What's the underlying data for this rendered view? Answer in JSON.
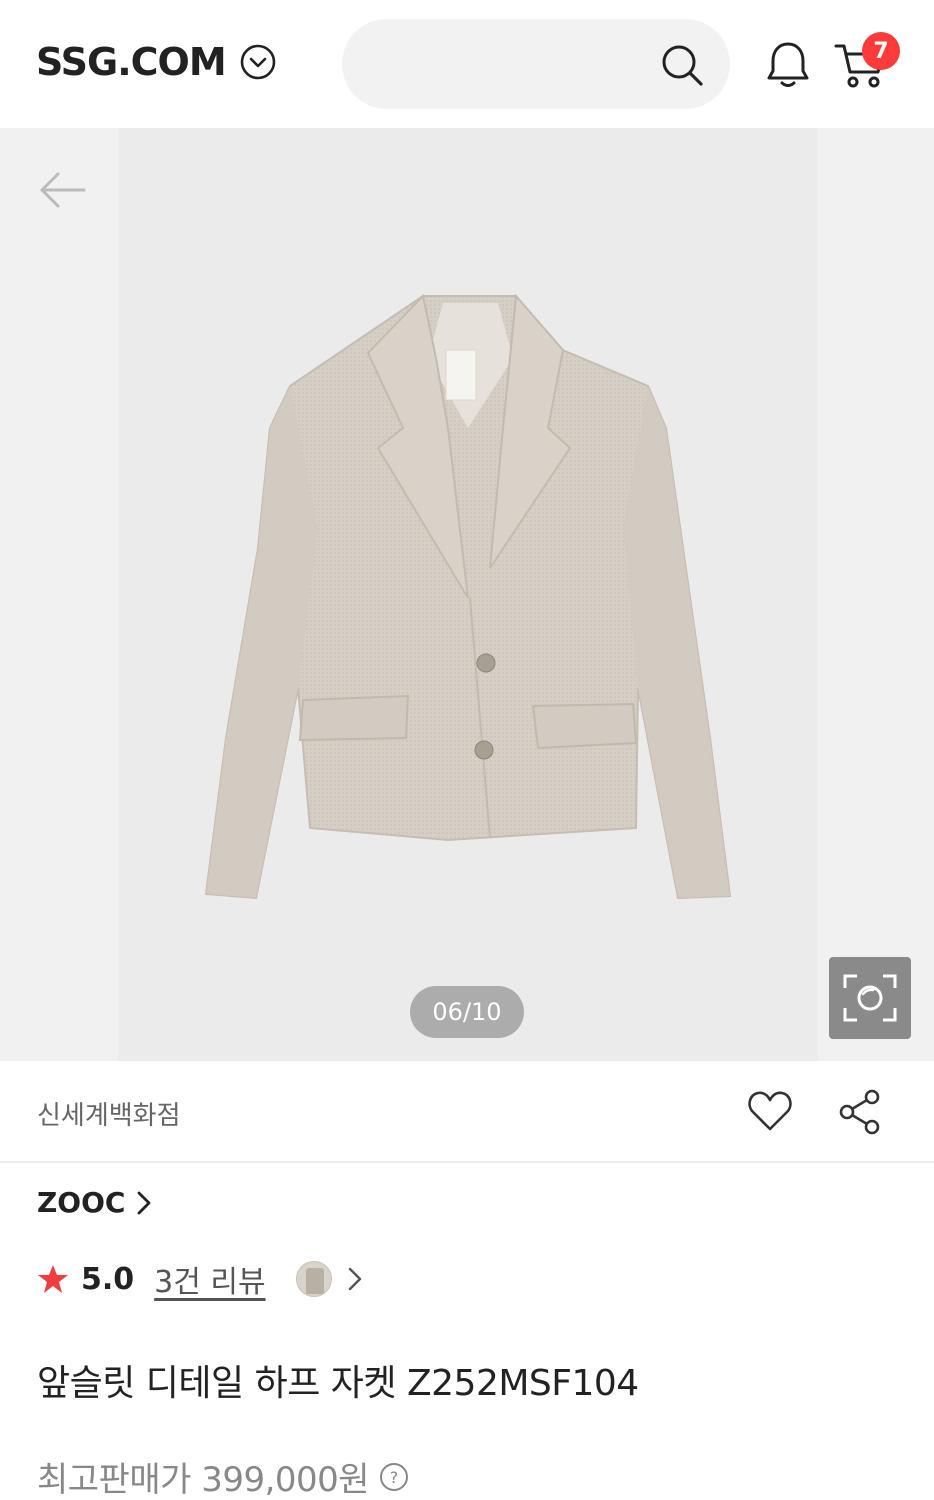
{
  "header": {
    "logo": "SSG.COM",
    "logo_dropdown_icon": "chevron-circle-down-icon",
    "search_icon": "search-icon",
    "bell_icon": "bell-icon",
    "cart_icon": "cart-icon",
    "cart_count": "7",
    "colors": {
      "badge": "#ff3a3a",
      "search_bg": "#f2f2f2"
    }
  },
  "gallery": {
    "back_icon": "arrow-left-icon",
    "image_alt_subject": "beige half jacket",
    "counter": "06/10",
    "lens_icon": "camera-search-icon"
  },
  "store": {
    "name": "신세계백화점",
    "wishlist_icon": "heart-icon",
    "share_icon": "share-icon"
  },
  "brand": {
    "name": "ZOOC",
    "chevron_icon": "chevron-right-icon"
  },
  "rating": {
    "star_icon": "star-icon",
    "score": "5.0",
    "review_link": "3건 리뷰",
    "thumb": "review-thumbnail",
    "chevron_icon": "chevron-right-icon",
    "star_color": "#f03e3e"
  },
  "product": {
    "title": "앞슬릿 디테일 하프 자켓 Z252MSF104",
    "price_label": "최고판매가 399,000원",
    "help_icon": "question-circle-icon"
  }
}
